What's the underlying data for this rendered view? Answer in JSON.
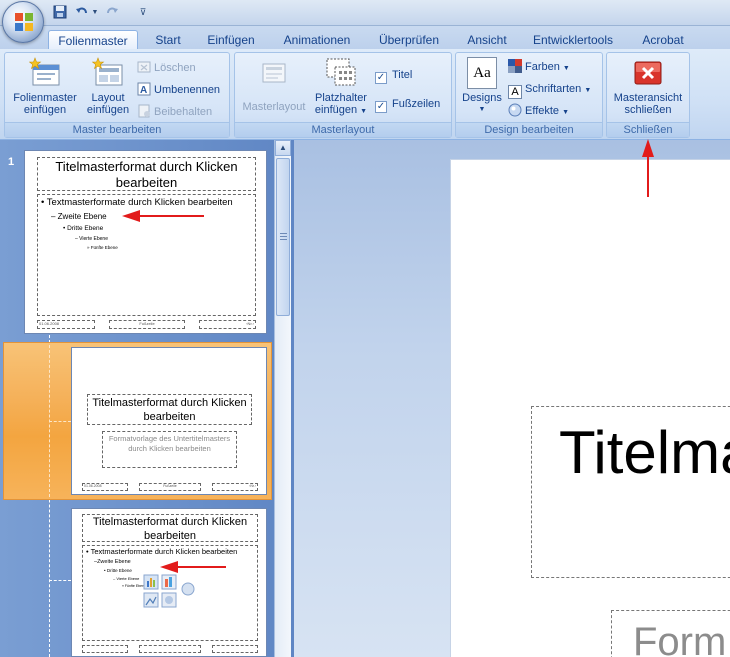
{
  "quick_access": {
    "icons": [
      "save-icon",
      "undo-icon",
      "redo-icon",
      "customize-icon"
    ]
  },
  "tabs": [
    {
      "label": "Folienmaster",
      "active": true
    },
    {
      "label": "Start"
    },
    {
      "label": "Einfügen"
    },
    {
      "label": "Animationen"
    },
    {
      "label": "Überprüfen"
    },
    {
      "label": "Ansicht"
    },
    {
      "label": "Entwicklertools"
    },
    {
      "label": "Acrobat"
    }
  ],
  "ribbon": {
    "master_bearbeiten": {
      "label": "Master bearbeiten",
      "folienmaster_einfuegen_1": "Folienmaster",
      "folienmaster_einfuegen_2": "einfügen",
      "layout_einfuegen_1": "Layout",
      "layout_einfuegen_2": "einfügen",
      "loeschen": "Löschen",
      "umbenennen": "Umbenennen",
      "beibehalten": "Beibehalten"
    },
    "masterlayout": {
      "label": "Masterlayout",
      "masterlayout_btn": "Masterlayout",
      "platzhalter_1": "Platzhalter",
      "platzhalter_2": "einfügen",
      "titel": "Titel",
      "fusszeilen": "Fußzeilen"
    },
    "design_bearbeiten": {
      "label": "Design bearbeiten",
      "designs": "Designs",
      "designs_icon_text": "Aa",
      "farben": "Farben",
      "schriftarten": "Schriftarten",
      "effekte": "Effekte"
    },
    "schliessen": {
      "label": "Schließen",
      "masteransicht_1": "Masteransicht",
      "masteransicht_2": "schließen"
    }
  },
  "left_panel": {
    "slide_number": "1",
    "thumb1": {
      "title": "Titelmasterformat durch Klicken bearbeiten",
      "level1": "Textmasterformate durch Klicken bearbeiten",
      "level2": "Zweite Ebene",
      "level3": "Dritte Ebene",
      "level4": "Vierte Ebene",
      "level5": "Fünfte Ebene",
      "footer_date": "01.06.2008",
      "footer_mid": "Fußzeile",
      "footer_num": "‹Nr.›"
    },
    "thumb2": {
      "title": "Titelmasterformat durch Klicken bearbeiten",
      "subtitle": "Formatvorlage des Untertitelmasters durch Klicken bearbeiten",
      "footer_date": "01.06.2008",
      "footer_mid": "Fußzeile",
      "footer_num": "‹Nr.›"
    },
    "thumb3": {
      "title": "Titelmasterformat durch Klicken bearbeiten",
      "level1": "Textmasterformate durch Klicken bearbeiten",
      "level2": "Zweite Ebene",
      "level3": "Dritte Ebene",
      "level4": "Vierte Ebene",
      "level5": "Fünfte Ebene"
    }
  },
  "main_slide": {
    "title_partial": "Titelma",
    "subtitle_partial": "Form"
  },
  "colors": {
    "accent_red": "#e21b1b",
    "selection": "#f5b15a",
    "ribbon": "#d5e4f7"
  }
}
